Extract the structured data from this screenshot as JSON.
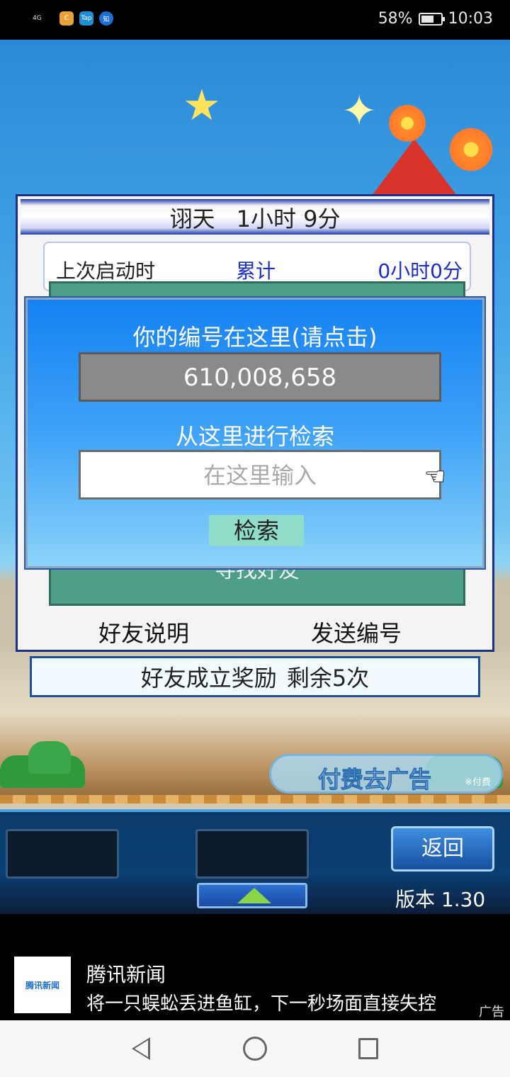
{
  "status_bar": {
    "signal": "4G",
    "apps": [
      "C",
      "Tap",
      "知"
    ],
    "battery_percent": "58%",
    "time": "10:03"
  },
  "profile": {
    "name": "诩天",
    "playtime": "1小时 9分",
    "last_launch_label": "上次启动时",
    "total_label": "累计",
    "total_value": "0小时0分",
    "find_friend_label": "寻找好友",
    "friend_help_button": "好友说明",
    "send_code_button": "发送编号"
  },
  "reward_bar": {
    "label": "好友成立奖励",
    "remaining": "剩余5次"
  },
  "dialog": {
    "title": "你的编号在这里(请点击)",
    "code": "610,008,658",
    "search_label": "从这里进行检索",
    "search_placeholder": "在这里输入",
    "search_button": "检索"
  },
  "remove_ad": {
    "label": "付费去广告",
    "sub": "※付费"
  },
  "toolbar": {
    "back_button": "返回",
    "version": "版本 1.30"
  },
  "ad": {
    "logo_text": "腾讯新闻",
    "title": "腾讯新闻",
    "desc": "将一只蜈蚣丢进鱼缸，下一秒场面直接失控",
    "tag": "广告"
  },
  "colors": {
    "dialog_blue": "#1582f2",
    "panel_border": "#1b2f8c",
    "teal": "#4f9e8a",
    "link_blue": "#1c2ecf"
  }
}
